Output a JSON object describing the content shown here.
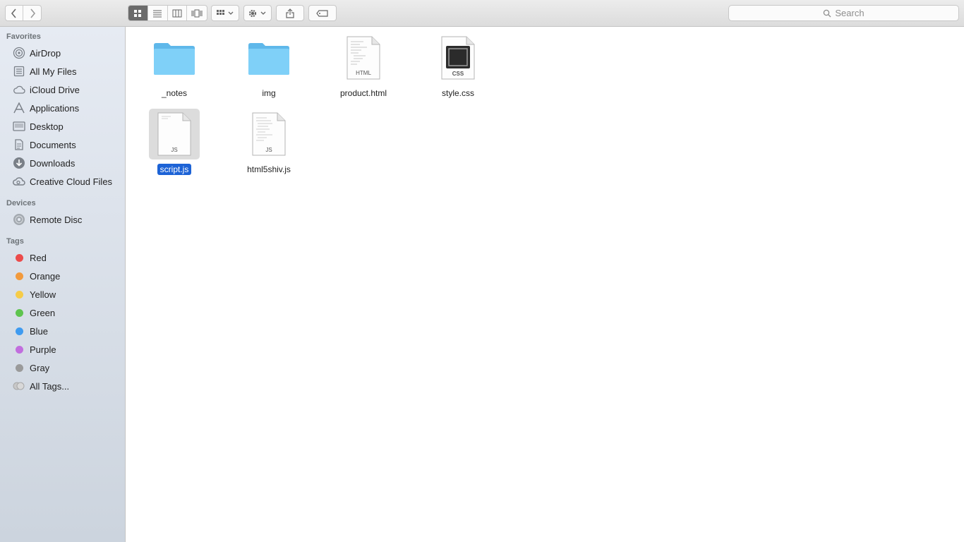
{
  "toolbar": {
    "search_placeholder": "Search"
  },
  "sidebar": {
    "favorites_title": "Favorites",
    "favorites": [
      {
        "label": "AirDrop",
        "icon": "airdrop-icon"
      },
      {
        "label": "All My Files",
        "icon": "all-files-icon"
      },
      {
        "label": "iCloud Drive",
        "icon": "cloud-icon"
      },
      {
        "label": "Applications",
        "icon": "applications-icon"
      },
      {
        "label": "Desktop",
        "icon": "desktop-icon"
      },
      {
        "label": "Documents",
        "icon": "documents-icon"
      },
      {
        "label": "Downloads",
        "icon": "downloads-icon"
      },
      {
        "label": "Creative Cloud Files",
        "icon": "creative-cloud-icon"
      }
    ],
    "devices_title": "Devices",
    "devices": [
      {
        "label": "Remote Disc",
        "icon": "disc-icon"
      }
    ],
    "tags_title": "Tags",
    "tags": [
      {
        "label": "Red",
        "color": "#ec4b4b"
      },
      {
        "label": "Orange",
        "color": "#f29a3d"
      },
      {
        "label": "Yellow",
        "color": "#f6cc48"
      },
      {
        "label": "Green",
        "color": "#5ec44e"
      },
      {
        "label": "Blue",
        "color": "#3f9bf0"
      },
      {
        "label": "Purple",
        "color": "#c16ede"
      },
      {
        "label": "Gray",
        "color": "#9a9a9a"
      },
      {
        "label": "All Tags...",
        "color": "#c8c8c8"
      }
    ]
  },
  "files": [
    {
      "name": "_notes",
      "type": "folder"
    },
    {
      "name": "img",
      "type": "folder"
    },
    {
      "name": "product.html",
      "type": "doc",
      "badge": "HTML"
    },
    {
      "name": "style.css",
      "type": "css",
      "badge": "CSS"
    },
    {
      "name": "script.js",
      "type": "doc",
      "badge": "JS",
      "selected": true
    },
    {
      "name": "html5shiv.js",
      "type": "doc",
      "badge": "JS"
    }
  ],
  "colors": {
    "accent": "#1d63d6",
    "folder": "#6fc7f5"
  }
}
